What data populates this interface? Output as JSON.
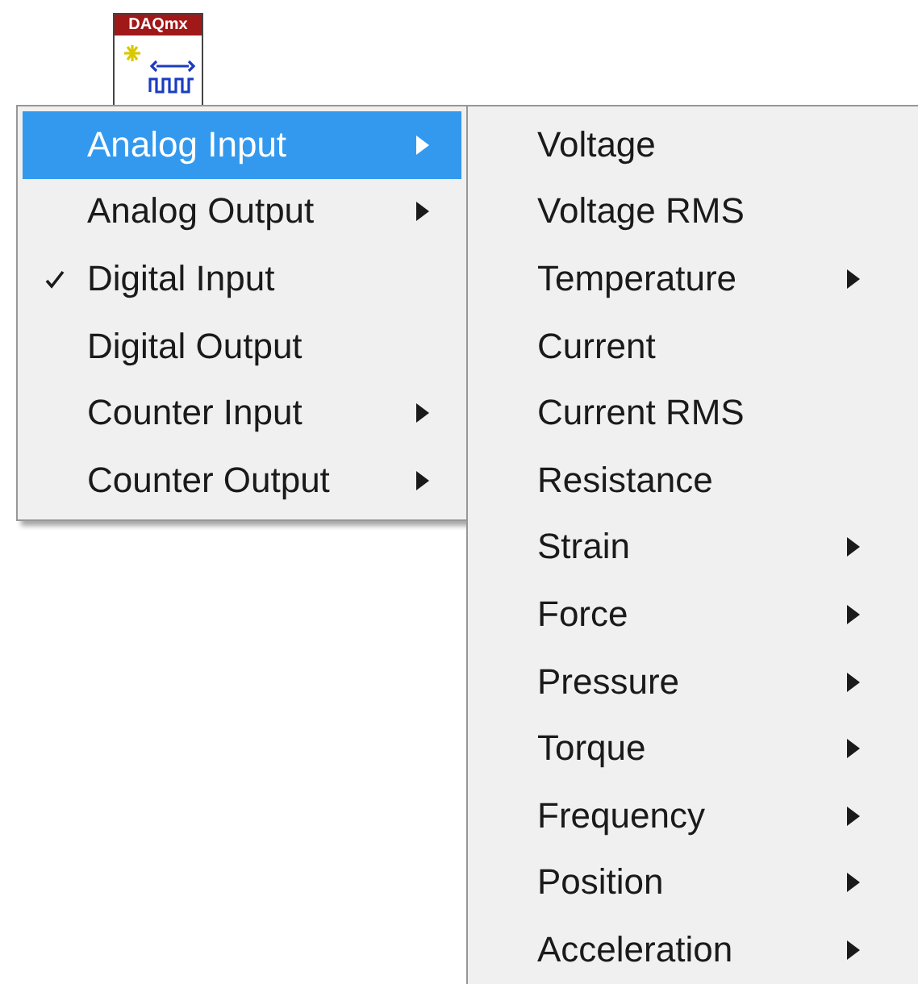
{
  "block_icon": {
    "label": "DAQmx"
  },
  "menu": {
    "items": [
      {
        "label": "Analog Input",
        "has_submenu": true,
        "checked": false,
        "selected": true
      },
      {
        "label": "Analog Output",
        "has_submenu": true,
        "checked": false,
        "selected": false
      },
      {
        "label": "Digital Input",
        "has_submenu": false,
        "checked": true,
        "selected": false
      },
      {
        "label": "Digital Output",
        "has_submenu": false,
        "checked": false,
        "selected": false
      },
      {
        "label": "Counter Input",
        "has_submenu": true,
        "checked": false,
        "selected": false
      },
      {
        "label": "Counter Output",
        "has_submenu": true,
        "checked": false,
        "selected": false
      }
    ]
  },
  "submenu": {
    "items": [
      {
        "label": "Voltage",
        "has_submenu": false,
        "selected": false
      },
      {
        "label": "Voltage RMS",
        "has_submenu": false,
        "selected": false
      },
      {
        "label": "Temperature",
        "has_submenu": true,
        "selected": false
      },
      {
        "label": "Current",
        "has_submenu": false,
        "selected": false
      },
      {
        "label": "Current RMS",
        "has_submenu": false,
        "selected": false
      },
      {
        "label": "Resistance",
        "has_submenu": false,
        "selected": false
      },
      {
        "label": "Strain",
        "has_submenu": true,
        "selected": false
      },
      {
        "label": "Force",
        "has_submenu": true,
        "selected": false
      },
      {
        "label": "Pressure",
        "has_submenu": true,
        "selected": false
      },
      {
        "label": "Torque",
        "has_submenu": true,
        "selected": false
      },
      {
        "label": "Frequency",
        "has_submenu": true,
        "selected": false
      },
      {
        "label": "Position",
        "has_submenu": true,
        "selected": false
      },
      {
        "label": "Acceleration",
        "has_submenu": true,
        "selected": false
      }
    ]
  }
}
